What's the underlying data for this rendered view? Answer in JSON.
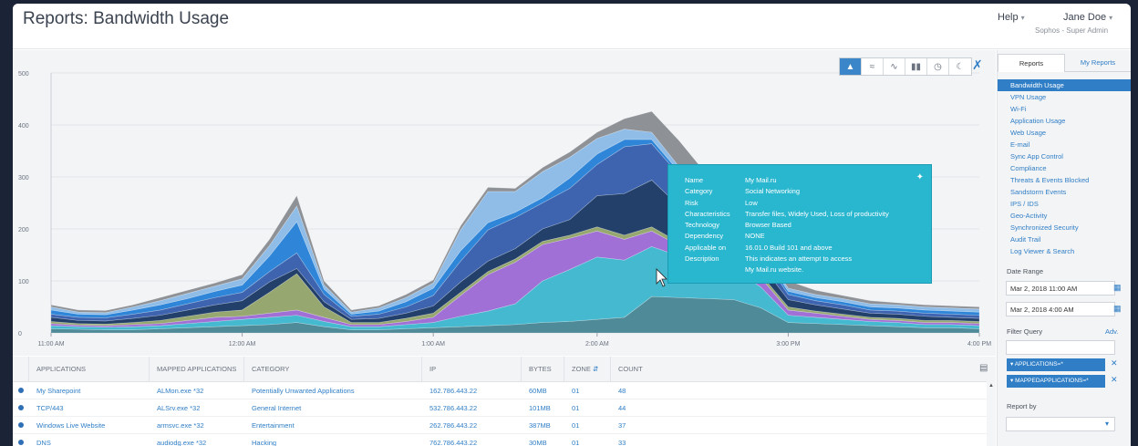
{
  "header": {
    "title": "Reports: Bandwidth Usage",
    "help_label": "Help",
    "user_name": "Jane Doe",
    "user_role": "Sophos - Super Admin"
  },
  "chart_data": {
    "type": "area",
    "x": [
      "11:00 AM",
      "",
      "",
      "",
      "",
      "",
      "12:00 AM",
      "",
      "",
      "",
      "",
      "",
      "",
      "1:00 AM",
      "",
      "",
      "",
      "",
      "",
      "",
      "2:00 AM",
      "",
      "",
      "",
      "",
      "",
      "",
      "3:00 PM",
      "",
      "",
      "",
      "",
      "",
      "",
      "4:00 PM"
    ],
    "xticks": [
      "11:00 AM",
      "12:00 AM",
      "1:00 AM",
      "2:00 AM",
      "3:00 PM",
      "4:00 PM"
    ],
    "ylim": [
      0,
      500
    ],
    "yticks": [
      0,
      100,
      200,
      300,
      400,
      500
    ],
    "series": [
      {
        "color": "#4f8a98",
        "values": [
          8,
          7,
          6,
          6,
          8,
          10,
          12,
          14,
          16,
          20,
          12,
          6,
          6,
          8,
          10,
          12,
          14,
          16,
          20,
          22,
          26,
          30,
          70,
          68,
          66,
          64,
          48,
          20,
          18,
          16,
          14,
          12,
          10,
          10,
          8
        ]
      },
      {
        "color": "#45b9cf",
        "values": [
          6,
          5,
          5,
          6,
          6,
          8,
          10,
          12,
          14,
          14,
          10,
          6,
          6,
          8,
          10,
          20,
          28,
          40,
          80,
          100,
          120,
          110,
          96,
          80,
          70,
          60,
          40,
          14,
          12,
          10,
          8,
          8,
          6,
          6,
          6
        ]
      },
      {
        "color": "#a070d6",
        "values": [
          4,
          3,
          3,
          4,
          4,
          6,
          8,
          6,
          8,
          10,
          8,
          4,
          4,
          6,
          10,
          40,
          70,
          80,
          70,
          60,
          50,
          40,
          30,
          20,
          20,
          20,
          18,
          10,
          8,
          6,
          4,
          4,
          4,
          4,
          4
        ]
      },
      {
        "color": "#96a86f",
        "values": [
          4,
          3,
          3,
          4,
          6,
          8,
          10,
          12,
          40,
          70,
          20,
          4,
          4,
          6,
          8,
          6,
          6,
          6,
          6,
          6,
          8,
          8,
          8,
          6,
          6,
          6,
          6,
          6,
          4,
          4,
          4,
          4,
          4,
          4,
          4
        ]
      },
      {
        "color": "#23406a",
        "values": [
          8,
          6,
          6,
          8,
          10,
          12,
          14,
          18,
          20,
          10,
          10,
          6,
          8,
          10,
          14,
          20,
          20,
          20,
          24,
          30,
          60,
          80,
          90,
          70,
          50,
          30,
          20,
          14,
          12,
          10,
          8,
          8,
          8,
          6,
          6
        ]
      },
      {
        "color": "#3e64b0",
        "values": [
          6,
          6,
          6,
          8,
          10,
          12,
          14,
          16,
          20,
          30,
          14,
          6,
          8,
          12,
          20,
          40,
          60,
          60,
          50,
          60,
          60,
          90,
          70,
          60,
          40,
          30,
          20,
          10,
          8,
          8,
          6,
          6,
          6,
          6,
          6
        ]
      },
      {
        "color": "#2f86d8",
        "values": [
          8,
          6,
          6,
          8,
          10,
          10,
          12,
          14,
          30,
          60,
          10,
          4,
          6,
          10,
          14,
          20,
          14,
          10,
          10,
          20,
          20,
          14,
          8,
          6,
          6,
          6,
          6,
          6,
          6,
          6,
          6,
          6,
          6,
          6,
          6
        ]
      },
      {
        "color": "#8fbde8",
        "values": [
          6,
          4,
          4,
          6,
          8,
          10,
          10,
          12,
          20,
          30,
          8,
          4,
          6,
          8,
          10,
          40,
          60,
          40,
          50,
          40,
          30,
          20,
          14,
          10,
          8,
          8,
          6,
          6,
          6,
          6,
          6,
          6,
          6,
          6,
          6
        ]
      },
      {
        "color": "#8e9196",
        "values": [
          4,
          4,
          4,
          4,
          6,
          6,
          6,
          8,
          12,
          20,
          8,
          4,
          4,
          6,
          6,
          8,
          8,
          6,
          8,
          10,
          12,
          20,
          40,
          50,
          40,
          30,
          20,
          14,
          8,
          6,
          6,
          4,
          4,
          4,
          4
        ]
      }
    ]
  },
  "toolbar": {
    "icons": [
      "area-chart-icon",
      "stacked-area-icon",
      "line-chart-icon",
      "bar-chart-icon",
      "clock-icon",
      "moon-icon",
      "tools-icon"
    ]
  },
  "tooltip": {
    "rows": [
      {
        "k": "Name",
        "v": "My Mail.ru"
      },
      {
        "k": "Category",
        "v": "Social Networking"
      },
      {
        "k": "Risk",
        "v": "Low"
      },
      {
        "k": "Characteristics",
        "v": "Transfer files, Widely Used, Loss of productivity"
      },
      {
        "k": "Technology",
        "v": "Browser Based"
      },
      {
        "k": "Dependency",
        "v": "NONE"
      },
      {
        "k": "Applicable on",
        "v": "16.01.0 Build 101 and above"
      },
      {
        "k": "Description",
        "v": "This indicates an attempt to access"
      },
      {
        "k": "",
        "v": "My Mail.ru website."
      }
    ]
  },
  "table": {
    "headers": [
      "APPLICATIONS",
      "MAPPED APPLICATIONS",
      "CATEGORY",
      "IP",
      "BYTES",
      "ZONE",
      "COUNT"
    ],
    "rows": [
      [
        "My Sharepoint",
        "ALMon.exe *32",
        "Potentially Unwanted Applications",
        "162.786.443.22",
        "60MB",
        "01",
        "48"
      ],
      [
        "TCP/443",
        "ALSrv.exe *32",
        "General Internet",
        "532.786.443.22",
        "101MB",
        "01",
        "44"
      ],
      [
        "Windows Live Website",
        "armsvc.exe *32",
        "Entertainment",
        "262.786.443.22",
        "387MB",
        "01",
        "37"
      ],
      [
        "DNS",
        "audiodg.exe *32",
        "Hacking",
        "762.786.443.22",
        "30MB",
        "01",
        "33"
      ]
    ]
  },
  "sidebar": {
    "tabs": [
      "Reports",
      "My Reports"
    ],
    "items": [
      "Bandwidth Usage",
      "VPN Usage",
      "Wi-Fi",
      "Application Usage",
      "Web Usage",
      "E-mail",
      "Sync App Control",
      "Compliance",
      "Threats & Events Blocked",
      "Sandstorm Events",
      "IPS / IDS",
      "Geo-Activity",
      "Synchronized Security",
      "Audit Trail",
      "Log Viewer & Search"
    ],
    "date_range_label": "Date Range",
    "date_from": "Mar 2, 2018  11:00 AM",
    "date_to": "Mar 2, 2018  4:00 AM",
    "filter_label": "Filter Query",
    "adv_label": "Adv.",
    "chips": [
      "APPLICATIONS=*",
      "MAPPEDAPPLICATIONS=*"
    ],
    "report_by_label": "Report by"
  }
}
